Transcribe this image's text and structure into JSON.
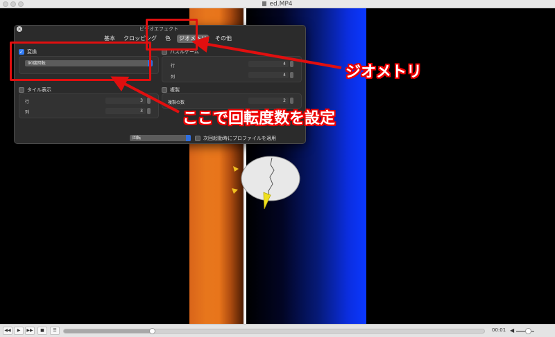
{
  "window": {
    "title": "ed.MP4"
  },
  "panel": {
    "title": "ビデオエフェクト",
    "close_symbol": "×",
    "tabs": [
      "基本",
      "クロッピング",
      "色",
      "ジオメトリ",
      "その他"
    ],
    "active_tab": "ジオメトリ",
    "transform": {
      "label": "変換",
      "checked": true,
      "selected": "90度回転"
    },
    "puzzle": {
      "label": "パズルゲーム",
      "checked": false,
      "row_label": "行",
      "row_value": "4",
      "col_label": "列",
      "col_value": "4"
    },
    "tile": {
      "label": "タイル表示",
      "checked": false,
      "row_label": "行",
      "row_value": "3",
      "col_label": "列",
      "col_value": "3"
    },
    "clone": {
      "label": "複製",
      "checked": false,
      "count_label": "複製の数",
      "count_value": "2"
    },
    "profile_select": "回転",
    "apply_on_launch": {
      "label": "次回起動時にプロファイルを適用",
      "checked": false
    }
  },
  "annotations": {
    "geometry": "ジオメトリ",
    "rotation": "ここで回転度数を設定",
    "color": "#e10f0f"
  },
  "controls": {
    "rewind_icon": "◀◀",
    "play_icon": "▶",
    "forward_icon": "▶▶",
    "stop_icon": "■",
    "playlist_icon": "☰",
    "time": "00:01",
    "volume_icon": "◀",
    "playback_progress": 0.21,
    "volume_level": 0.5
  }
}
